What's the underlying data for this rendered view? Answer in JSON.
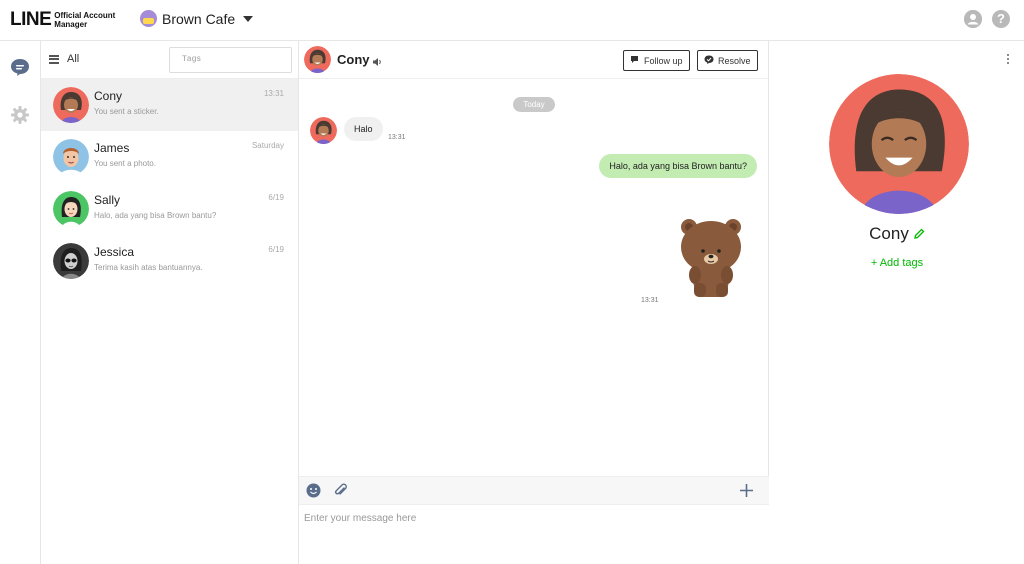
{
  "app": {
    "logo_text": "LINE",
    "logo_sub_line1": "Official Account",
    "logo_sub_line2": "Manager",
    "account_name": "Brown Cafe"
  },
  "icons": {
    "top_right": [
      "profile-icon",
      "help-icon"
    ],
    "help_glyph": "?",
    "left_nav": [
      "chat-icon",
      "settings-icon"
    ]
  },
  "chat_list": {
    "filter_label": "All",
    "tags_placeholder": "Tags",
    "items": [
      {
        "name": "Cony",
        "preview": "You sent a sticker.",
        "time": "13:31",
        "active": true
      },
      {
        "name": "James",
        "preview": "You sent a photo.",
        "time": "Saturday"
      },
      {
        "name": "Sally",
        "preview": "Halo, ada yang bisa Brown bantu?",
        "time": "6/19"
      },
      {
        "name": "Jessica",
        "preview": "Terima kasih atas bantuannya.",
        "time": "6/19"
      }
    ]
  },
  "conversation": {
    "name": "Cony",
    "follow_up_label": "Follow up",
    "resolve_label": "Resolve",
    "date_divider": "Today",
    "incoming_text": "Halo",
    "incoming_time": "13:31",
    "outgoing_text": "Halo, ada yang bisa Brown bantu?",
    "sticker_time": "13:31",
    "composer_placeholder": "Enter your message here"
  },
  "profile": {
    "name": "Cony",
    "add_tags_label": "+ Add tags"
  },
  "colors": {
    "brand_green": "#00b900",
    "outgoing_bubble": "#c3ecb3",
    "incoming_bubble": "#f0f0f0",
    "nav_active": "#5a6e8c"
  }
}
